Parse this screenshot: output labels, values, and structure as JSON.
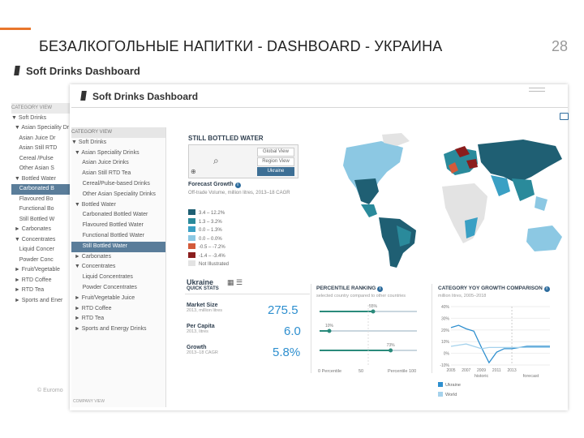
{
  "slide": {
    "title": "БЕЗАЛКОГОЛЬНЫЕ НАПИТКИ - DASHBOARD - УКРАИНА",
    "page_number": "28"
  },
  "app": {
    "title_back": "Soft Drinks Dashboard",
    "title_front": "Soft Drinks Dashboard",
    "footer_brand": "© Euromo",
    "footer_caption": "COMPANY VIEW"
  },
  "tree_back": {
    "items": [
      {
        "label": "CATEGORY VIEW",
        "kind": "cap"
      },
      {
        "label": "▼ Soft Drinks",
        "kind": "normal"
      },
      {
        "label": "  ▼ Asian Speciality Dr",
        "kind": "normal"
      },
      {
        "label": "     Asian Juice Dr",
        "kind": "normal"
      },
      {
        "label": "     Asian Still RTD",
        "kind": "normal"
      },
      {
        "label": "     Cereal /Pulse",
        "kind": "normal"
      },
      {
        "label": "     Other Asian S",
        "kind": "normal"
      },
      {
        "label": "  ▼ Bottled Water",
        "kind": "normal"
      },
      {
        "label": "     Carbonated B",
        "kind": "hl"
      },
      {
        "label": "     Flavoured Bo",
        "kind": "normal"
      },
      {
        "label": "     Functional Bo",
        "kind": "normal"
      },
      {
        "label": "     Still Bottled W",
        "kind": "normal"
      },
      {
        "label": "  ► Carbonates",
        "kind": "normal"
      },
      {
        "label": "  ▼ Concentrates",
        "kind": "normal"
      },
      {
        "label": "     Liquid Concer",
        "kind": "normal"
      },
      {
        "label": "     Powder Conc",
        "kind": "normal"
      },
      {
        "label": "  ► Fruit/Vegetable",
        "kind": "normal"
      },
      {
        "label": "  ► RTD Coffee",
        "kind": "normal"
      },
      {
        "label": "  ► RTD Tea",
        "kind": "normal"
      },
      {
        "label": "  ► Sports and Ener",
        "kind": "normal"
      }
    ]
  },
  "tree_front": {
    "items": [
      {
        "label": "CATEGORY VIEW",
        "kind": "cap"
      },
      {
        "label": "▼ Soft Drinks",
        "kind": "normal"
      },
      {
        "label": "  ▼ Asian Speciality Drinks",
        "kind": "normal"
      },
      {
        "label": "       Asian Juice Drinks",
        "kind": "normal"
      },
      {
        "label": "       Asian Still RTD Tea",
        "kind": "normal"
      },
      {
        "label": "       Cereal/Pulse-based Drinks",
        "kind": "normal"
      },
      {
        "label": "       Other Asian Speciality Drinks",
        "kind": "normal"
      },
      {
        "label": "  ▼ Bottled Water",
        "kind": "normal"
      },
      {
        "label": "       Carbonated Bottled Water",
        "kind": "normal"
      },
      {
        "label": "       Flavoured Bottled Water",
        "kind": "normal"
      },
      {
        "label": "       Functional Bottled Water",
        "kind": "normal"
      },
      {
        "label": "       Still Bottled Water",
        "kind": "hl"
      },
      {
        "label": "  ► Carbonates",
        "kind": "normal"
      },
      {
        "label": "  ▼ Concentrates",
        "kind": "normal"
      },
      {
        "label": "       Liquid Concentrates",
        "kind": "normal"
      },
      {
        "label": "       Powder Concentrates",
        "kind": "normal"
      },
      {
        "label": "  ► Fruit/Vegetable Juice",
        "kind": "normal"
      },
      {
        "label": "  ► RTD Coffee",
        "kind": "normal"
      },
      {
        "label": "  ► RTD Tea",
        "kind": "normal"
      },
      {
        "label": "  ► Sports and Energy Drinks",
        "kind": "normal"
      }
    ]
  },
  "category_panel": {
    "title": "STILL BOTTLED WATER",
    "view_options": [
      "Global View",
      "Region View",
      "Ukraine"
    ],
    "forecast_title": "Forecast Growth",
    "forecast_sub": "Off-trade Volume, million litres, 2013–18 CAGR",
    "legend": [
      {
        "label": "3.4 – 12.2%",
        "color": "#1f5f73"
      },
      {
        "label": "1.3 – 3.2%",
        "color": "#2a8a9b"
      },
      {
        "label": "0.0 – 1.3%",
        "color": "#3aa0c4"
      },
      {
        "label": "0.0 – 0.0%",
        "color": "#8cc8e3"
      },
      {
        "label": "-0.5 – -7.2%",
        "color": "#d35a3a"
      },
      {
        "label": "-1.4 – -3.4%",
        "color": "#8a1d1d"
      },
      {
        "label": "Not Illustrated",
        "color": "#e3e3e3"
      }
    ]
  },
  "country": {
    "name": "Ukraine",
    "quick_stats_label": "QUICK STATS",
    "stats": [
      {
        "label": "Market Size",
        "sub": "2013, million litres",
        "value": "275.5"
      },
      {
        "label": "Per Capita",
        "sub": "2013, litres",
        "value": "6.0"
      },
      {
        "label": "Growth",
        "sub": "2013–18 CAGR",
        "value": "5.8%"
      }
    ]
  },
  "percentile": {
    "title": "PERCENTILE RANKING",
    "sub": "selected country compared to other countries",
    "marker_labels": [
      "55%",
      "10%",
      "73%"
    ],
    "axis_labels": [
      "0 Percentile",
      "50",
      "Percentile 100"
    ],
    "positions": [
      0.55,
      0.1,
      0.73
    ]
  },
  "yoy": {
    "title": "CATEGORY YOY GROWTH COMPARISON",
    "sub": "million litres, 2005–2018",
    "historic_label": "historic",
    "forecast_label": "forecast",
    "legend": [
      "Ukraine",
      "World"
    ],
    "colors": [
      "#2e8fcf",
      "#a5d2ec"
    ]
  },
  "chart_data": {
    "type": "line",
    "title": "CATEGORY YOY GROWTH COMPARISON",
    "x": [
      2005,
      2006,
      2007,
      2008,
      2009,
      2010,
      2011,
      2012,
      2013,
      2014,
      2015,
      2016,
      2017,
      2018
    ],
    "ylim": [
      -10,
      40
    ],
    "y_ticks": [
      40,
      30,
      20,
      10,
      0,
      -10
    ],
    "y_tick_labels": [
      "40%",
      "30%",
      "20%",
      "10%",
      "0%",
      "-10%"
    ],
    "x_tick_labels": [
      "2005",
      "2007",
      "2009",
      "2011",
      "2013"
    ],
    "series": [
      {
        "name": "Ukraine",
        "values": [
          22,
          24,
          21,
          19,
          5,
          -8,
          1,
          4,
          4,
          5,
          6,
          6,
          6,
          6
        ]
      },
      {
        "name": "World",
        "values": [
          6,
          7,
          8,
          6,
          4,
          5,
          5,
          5,
          5,
          5,
          5,
          5,
          5,
          5
        ]
      }
    ]
  }
}
